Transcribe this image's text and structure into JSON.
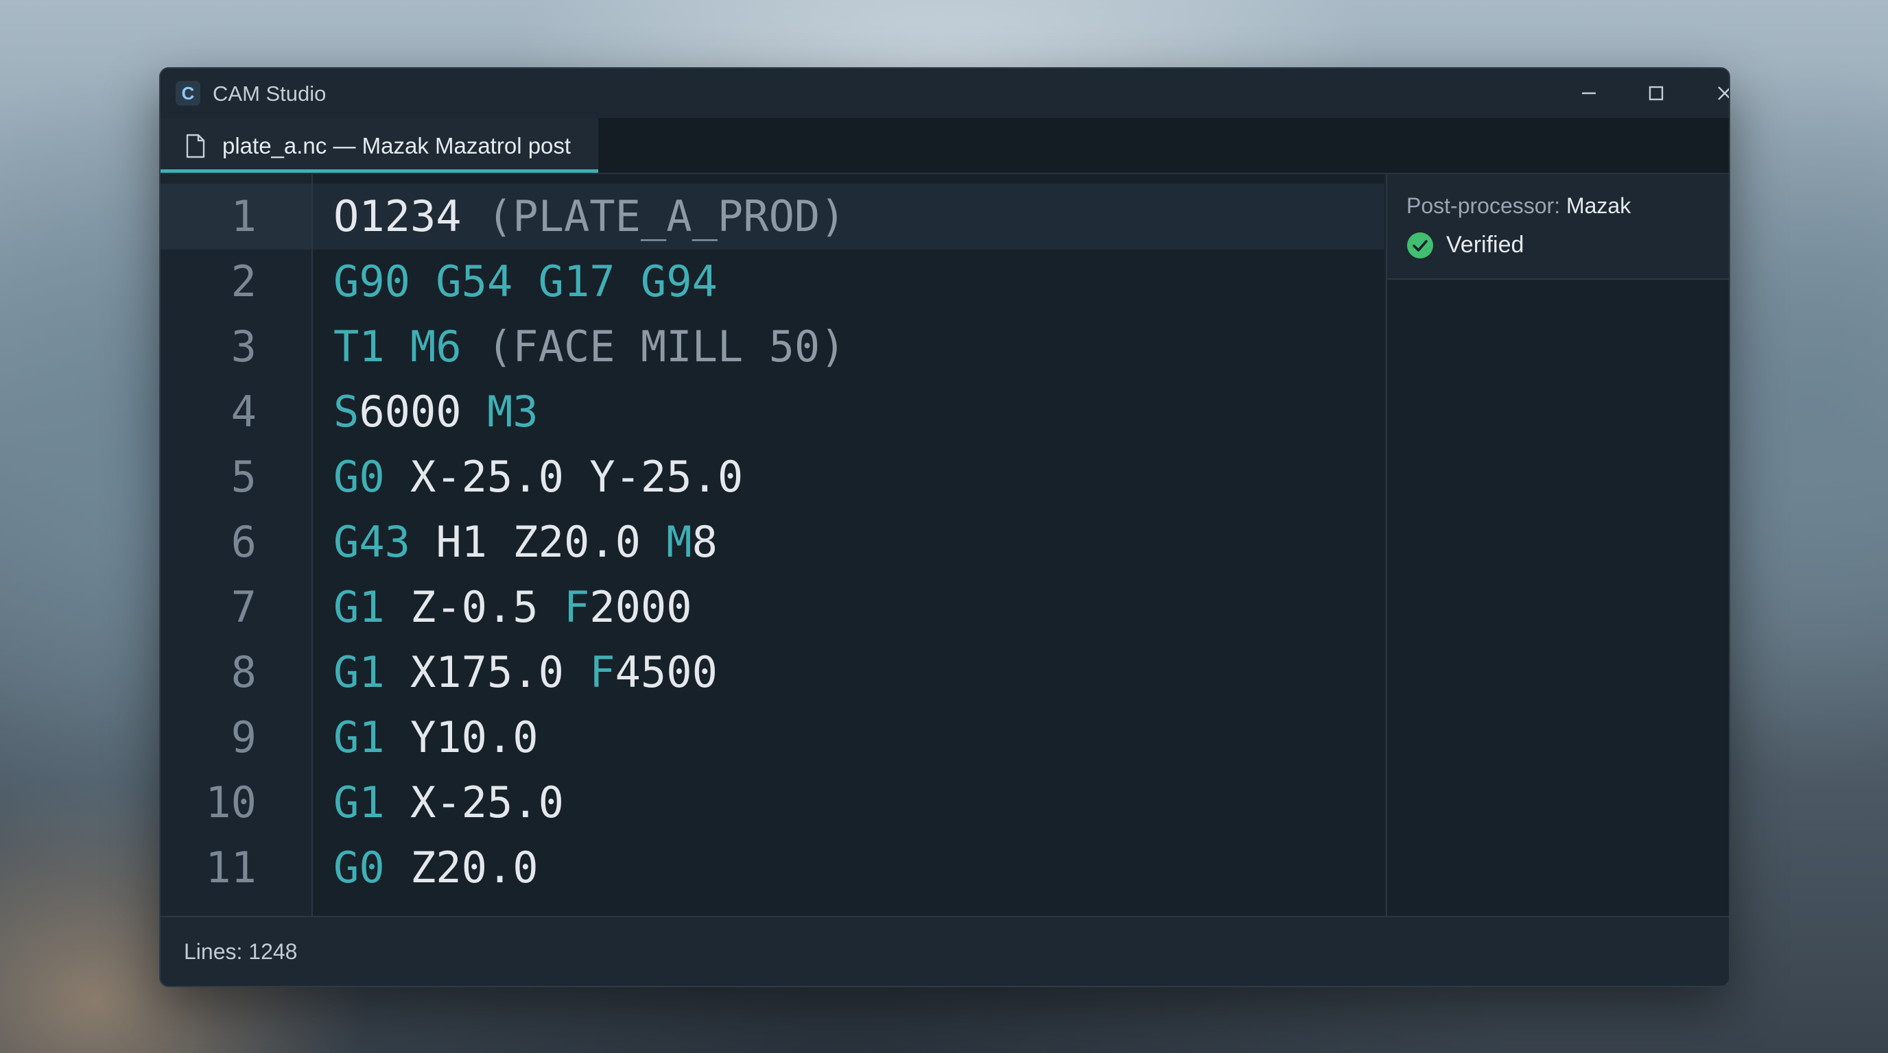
{
  "window": {
    "title": "CAM Studio",
    "logo_text": "C",
    "controls": [
      "minimize-icon",
      "maximize-icon",
      "close-icon"
    ]
  },
  "tab": {
    "label": "plate_a.nc — Mazak Mazatrol post",
    "icon": "file-icon"
  },
  "editor": {
    "lines": [
      {
        "num": "1",
        "tokens": [
          {
            "t": "O1234 ",
            "c": "tx"
          },
          {
            "t": "(PLATE_A_PROD)",
            "c": "cm"
          }
        ]
      },
      {
        "num": "2",
        "tokens": [
          {
            "t": "G90 G54 G17 G94",
            "c": "kw"
          }
        ]
      },
      {
        "num": "3",
        "tokens": [
          {
            "t": "T1 M6 ",
            "c": "kw"
          },
          {
            "t": "(FACE MILL 50)",
            "c": "cm"
          }
        ]
      },
      {
        "num": "4",
        "tokens": [
          {
            "t": "S",
            "c": "kw"
          },
          {
            "t": "6000 ",
            "c": "tx"
          },
          {
            "t": "M3",
            "c": "kw"
          }
        ]
      },
      {
        "num": "5",
        "tokens": [
          {
            "t": "G0 ",
            "c": "kw"
          },
          {
            "t": "X-25.0 Y-25.0",
            "c": "tx"
          }
        ]
      },
      {
        "num": "6",
        "tokens": [
          {
            "t": "G43 ",
            "c": "kw"
          },
          {
            "t": "H1 Z20.0 ",
            "c": "tx"
          },
          {
            "t": "M",
            "c": "kw"
          },
          {
            "t": "8",
            "c": "tx"
          }
        ]
      },
      {
        "num": "7",
        "tokens": [
          {
            "t": "G1 ",
            "c": "kw"
          },
          {
            "t": "Z-0.5 ",
            "c": "tx"
          },
          {
            "t": "F",
            "c": "kw"
          },
          {
            "t": "2000",
            "c": "tx"
          }
        ]
      },
      {
        "num": "8",
        "tokens": [
          {
            "t": "G1 ",
            "c": "kw"
          },
          {
            "t": "X175.0 ",
            "c": "tx"
          },
          {
            "t": "F",
            "c": "kw"
          },
          {
            "t": "4500",
            "c": "tx"
          }
        ]
      },
      {
        "num": "9",
        "tokens": [
          {
            "t": "G1 ",
            "c": "kw"
          },
          {
            "t": "Y10.0",
            "c": "tx"
          }
        ]
      },
      {
        "num": "10",
        "tokens": [
          {
            "t": "G1 ",
            "c": "kw"
          },
          {
            "t": "X-25.0",
            "c": "tx"
          }
        ]
      },
      {
        "num": "11",
        "tokens": [
          {
            "t": "G0 ",
            "c": "kw"
          },
          {
            "t": "Z20.0",
            "c": "tx"
          }
        ]
      }
    ]
  },
  "side_panel": {
    "post_processor_label": "Post-processor:",
    "post_processor_value": "Mazak",
    "status_label": "Verified",
    "status_icon": "check-circle-icon",
    "status_color": "#3fbf6f"
  },
  "status_bar": {
    "lines_text": "Lines: 1248"
  },
  "colors": {
    "accent": "#3fb0b5",
    "keyword": "#3fb0b5",
    "comment": "#8d99a5",
    "text": "#e4e8ec"
  }
}
